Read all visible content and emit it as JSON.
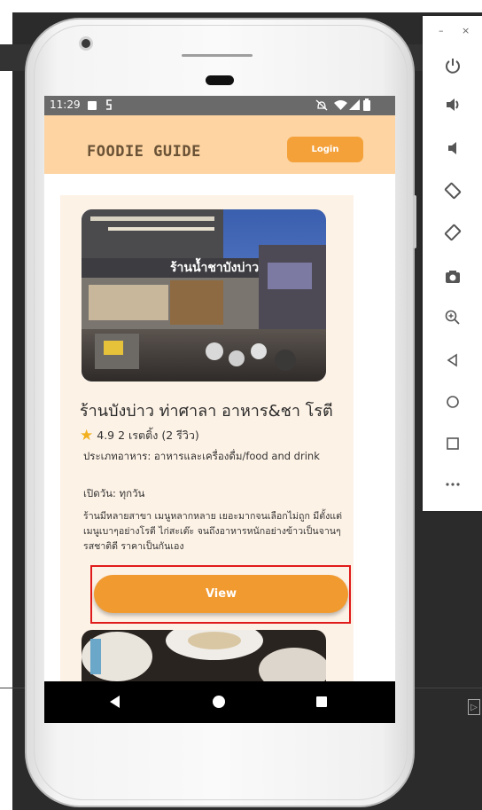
{
  "app": {
    "title": "FOODIE GUIDE",
    "login_label": "Login"
  },
  "status_bar": {
    "time": "11:29"
  },
  "restaurant": {
    "name": "ร้านบังบ่าว ท่าศาลา อาหาร&ชา โรตี",
    "rating_text": "4.9 2 เรตติ้ง (2 รีวิว)",
    "type_text": "ประเภทอาหาร:  อาหารและเครื่องดื่ม/food and drink",
    "open_text": "เปิดวัน: ทุกวัน",
    "description": "ร้านมีหลายสาขา เมนูหลากหลาย เยอะมากจนเลือกไม่ถูก มีตั้งแต่เมนูเบาๆอย่างโรตี ไก่สะเต๊ะ จนถึงอาหารหนักอย่างข้าวเป็นจานๆ รสชาติดี ราคาเป็นกันเอง",
    "view_label": "View"
  },
  "emulator_toolbar": {
    "minimize": "–",
    "close": "×",
    "icons": [
      "power-icon",
      "volume-up-icon",
      "volume-down-icon",
      "rotate-left-icon",
      "rotate-right-icon",
      "camera-icon",
      "zoom-in-icon",
      "back-icon",
      "home-icon",
      "overview-icon",
      "more-icon"
    ]
  },
  "colors": {
    "appbar": "#fdd4a2",
    "accent": "#f4a13a",
    "card": "#fdf2e6",
    "highlight": "#e01b1b"
  }
}
